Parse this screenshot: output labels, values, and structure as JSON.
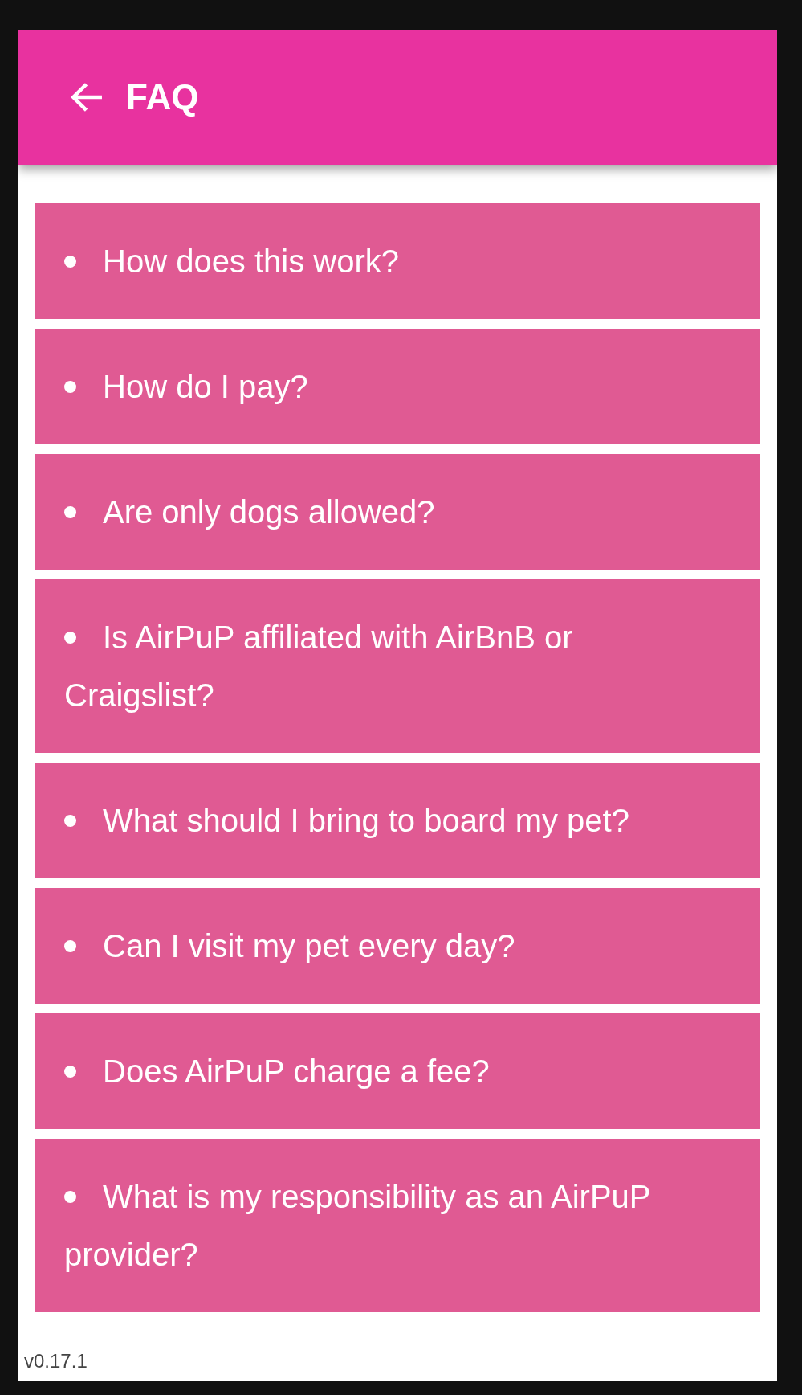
{
  "header": {
    "title": "FAQ"
  },
  "questions": [
    {
      "text": "How does this work?"
    },
    {
      "text": "How do I pay?"
    },
    {
      "text": "Are only dogs allowed?"
    },
    {
      "text": "Is AirPuP affiliated with AirBnB or Craigslist?"
    },
    {
      "text": "What should I bring to board my pet?"
    },
    {
      "text": "Can I visit my pet every day?"
    },
    {
      "text": "Does AirPuP charge a fee?"
    },
    {
      "text": "What is my responsibility as an AirPuP provider?"
    }
  ],
  "version": "v0.17.1"
}
